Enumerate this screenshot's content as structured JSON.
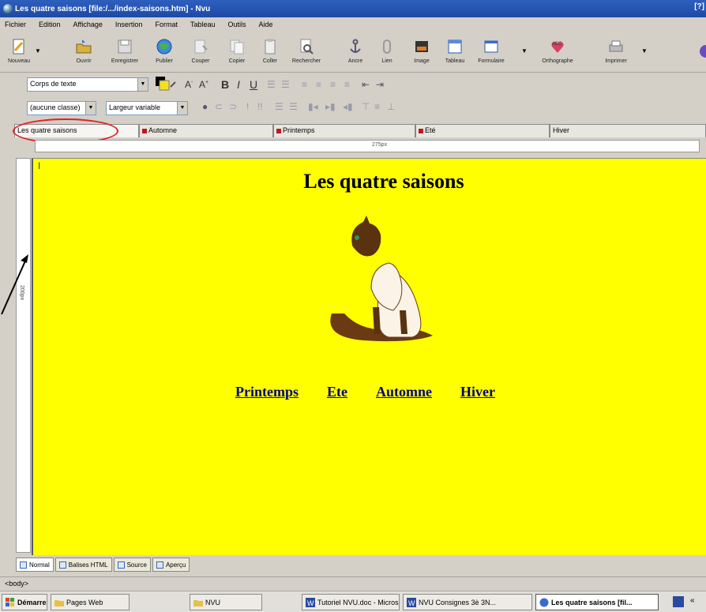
{
  "window": {
    "title": "Les quatre saisons [file:/.../index-saisons.htm] - Nvu",
    "edge_glyph": "[?]"
  },
  "menu": [
    "Fichier",
    "Edition",
    "Affichage",
    "Insertion",
    "Format",
    "Tableau",
    "Outils",
    "Aide"
  ],
  "toolbar": [
    {
      "label": "Nouveau",
      "icon": "new-page-icon"
    },
    {
      "label": "Ouvrir",
      "icon": "open-folder-icon"
    },
    {
      "label": "Enregistrer",
      "icon": "save-icon"
    },
    {
      "label": "Publier",
      "icon": "publish-globe-icon"
    },
    {
      "label": "Couper",
      "icon": "cut-icon"
    },
    {
      "label": "Copier",
      "icon": "copy-icon"
    },
    {
      "label": "Coller",
      "icon": "paste-icon"
    },
    {
      "label": "Rechercher",
      "icon": "find-icon"
    },
    {
      "label": "Ancre",
      "icon": "anchor-icon"
    },
    {
      "label": "Lien",
      "icon": "link-icon"
    },
    {
      "label": "Image",
      "icon": "image-icon"
    },
    {
      "label": "Tableau",
      "icon": "table-icon"
    },
    {
      "label": "Formulaire",
      "icon": "form-icon"
    },
    {
      "label": "Orthographe",
      "icon": "spellcheck-icon"
    },
    {
      "label": "Imprimer",
      "icon": "print-icon"
    }
  ],
  "format_bar": {
    "paragraph_style": "Corps de texte",
    "class_select": "(aucune classe)",
    "font_select": "Largeur variable"
  },
  "doc_tabs": [
    "Les quatre saisons",
    "Automne",
    "Printemps",
    "Eté",
    "Hiver"
  ],
  "ruler_label": "275px",
  "vruler_label": "200px",
  "page": {
    "cursor_glyph": "I",
    "title": "Les quatre saisons",
    "links": [
      "Printemps",
      "Ete",
      "Automne",
      "Hiver"
    ]
  },
  "view_tabs": [
    "Normal",
    "Balises HTML",
    "Source",
    "Aperçu"
  ],
  "status": "<body>",
  "taskbar": [
    {
      "label": "Démarrer"
    },
    {
      "label": "Pages Web"
    },
    {
      "label": "NVU"
    },
    {
      "label": "Tutoriel NVU.doc - Micros..."
    },
    {
      "label": "NVU Consignes 3è 3N..."
    },
    {
      "label": "Les quatre saisons [fil..."
    }
  ],
  "colors": {
    "page_background": "#ffff00",
    "link": "#00008b",
    "highlight_ellipse": "#e0202a",
    "titlebar": "#2458b6"
  }
}
